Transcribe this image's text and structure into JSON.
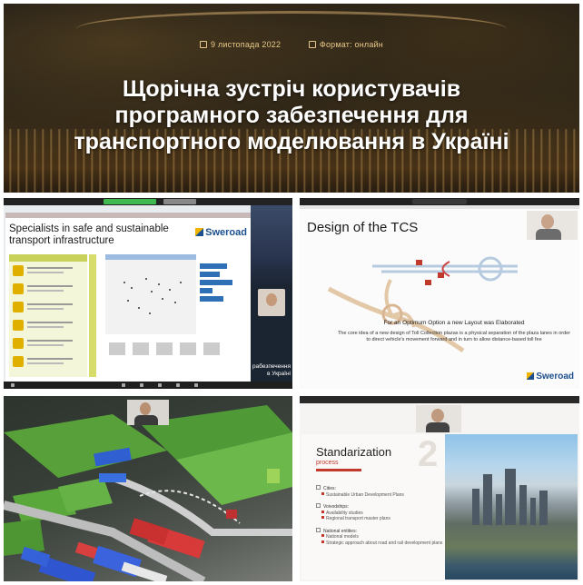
{
  "banner": {
    "date": "9 листопада 2022",
    "format": "Формат: онлайн",
    "title_line1": "Щорічна зустріч користувачів",
    "title_line2": "програмного забезпечення для",
    "title_line3": "транспортного моделювання в Україні",
    "icons": [
      "calendar-icon",
      "video-camera-icon"
    ]
  },
  "tile1": {
    "slide_title": "Specialists in safe and sustainable transport infrastructure",
    "logo": "Sweroad",
    "caption": "рабезпечення в Україні",
    "colors": {
      "accent": "#c8d25a",
      "item": "#e0b000",
      "bars": "#2f6fb5"
    }
  },
  "tile2": {
    "slide_title": "Design of the TCS",
    "subheading": "For an Optimum Option a new Layout was Elaborated",
    "body": "The core idea of a new design of Toll Collection plazas is a physical separation of the plaza lanes in order to direct vehicle's movement forward and in turn to allow distance-based toll fee",
    "logo": "Sweroad"
  },
  "tile4": {
    "title": "Standarization",
    "subtitle": "process",
    "number": "2",
    "groups": [
      {
        "head": "Cities:",
        "items": [
          "Sustainable Urban Development Plans"
        ]
      },
      {
        "head": "Voivodships:",
        "items": [
          "Availability studies",
          "Regional transport master plans"
        ]
      },
      {
        "head": "National entities:",
        "items": [
          "National models",
          "Strategic approach about road and rail development plans"
        ]
      }
    ]
  }
}
